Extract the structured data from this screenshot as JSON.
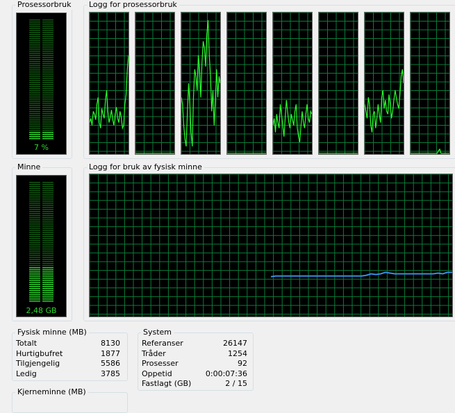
{
  "cpu": {
    "title": "Prosessorbruk",
    "value_label": "7 %",
    "fraction": 0.07
  },
  "cpu_history": {
    "title": "Logg for prosessorbruk",
    "cores": [
      [
        0.22,
        0.25,
        0.2,
        0.3,
        0.28,
        0.24,
        0.35,
        0.4,
        0.22,
        0.18,
        0.32,
        0.28,
        0.25,
        0.38,
        0.45,
        0.3,
        0.22,
        0.26,
        0.31,
        0.24,
        0.2,
        0.28,
        0.33,
        0.25,
        0.22,
        0.3,
        0.26,
        0.18,
        0.2,
        0.35,
        0.42,
        0.6,
        0.7
      ],
      [
        0.0,
        0.0,
        0.0,
        0.0,
        0.0,
        0.0,
        0.0,
        0.0,
        0.0,
        0.0,
        0.0,
        0.0,
        0.0,
        0.0,
        0.0,
        0.0,
        0.0,
        0.0,
        0.0,
        0.0,
        0.0,
        0.0,
        0.0,
        0.0,
        0.0,
        0.0,
        0.0,
        0.0,
        0.0,
        0.0,
        0.0,
        0.0,
        0.0
      ],
      [
        0.4,
        0.35,
        0.2,
        0.1,
        0.05,
        0.3,
        0.5,
        0.35,
        0.15,
        0.05,
        0.4,
        0.6,
        0.55,
        0.45,
        0.7,
        0.6,
        0.4,
        0.65,
        0.8,
        0.75,
        0.62,
        0.85,
        0.95,
        0.7,
        0.55,
        0.3,
        0.45,
        0.2,
        0.38,
        0.6,
        0.4,
        0.55,
        0.5
      ],
      [
        0.0,
        0.0,
        0.0,
        0.0,
        0.0,
        0.0,
        0.0,
        0.0,
        0.0,
        0.0,
        0.0,
        0.0,
        0.0,
        0.0,
        0.0,
        0.0,
        0.0,
        0.0,
        0.0,
        0.0,
        0.0,
        0.0,
        0.0,
        0.0,
        0.0,
        0.0,
        0.0,
        0.0,
        0.0,
        0.0,
        0.0,
        0.0,
        0.0
      ],
      [
        0.2,
        0.25,
        0.15,
        0.28,
        0.22,
        0.18,
        0.35,
        0.28,
        0.2,
        0.12,
        0.25,
        0.38,
        0.3,
        0.22,
        0.18,
        0.28,
        0.24,
        0.2,
        0.3,
        0.35,
        0.18,
        0.12,
        0.08,
        0.2,
        0.3,
        0.22,
        0.18,
        0.28,
        0.35,
        0.25,
        0.22,
        0.3,
        0.28
      ],
      [
        0.0,
        0.0,
        0.0,
        0.0,
        0.0,
        0.0,
        0.0,
        0.0,
        0.0,
        0.0,
        0.0,
        0.0,
        0.0,
        0.0,
        0.0,
        0.0,
        0.0,
        0.0,
        0.0,
        0.0,
        0.0,
        0.0,
        0.0,
        0.0,
        0.0,
        0.0,
        0.0,
        0.0,
        0.0,
        0.0,
        0.0,
        0.0,
        0.0
      ],
      [
        0.35,
        0.3,
        0.25,
        0.4,
        0.35,
        0.2,
        0.15,
        0.28,
        0.3,
        0.18,
        0.25,
        0.35,
        0.28,
        0.22,
        0.4,
        0.45,
        0.32,
        0.38,
        0.3,
        0.28,
        0.42,
        0.35,
        0.25,
        0.3,
        0.38,
        0.45,
        0.4,
        0.35,
        0.32,
        0.42,
        0.55,
        0.6,
        0.5
      ],
      [
        0.0,
        0.0,
        0.0,
        0.0,
        0.0,
        0.0,
        0.0,
        0.0,
        0.0,
        0.0,
        0.0,
        0.0,
        0.0,
        0.0,
        0.0,
        0.0,
        0.0,
        0.0,
        0.0,
        0.0,
        0.0,
        0.0,
        0.0,
        0.02,
        0.03,
        0.0,
        0.0,
        0.0,
        0.0,
        0.0,
        0.0,
        0.0,
        0.0
      ]
    ]
  },
  "memory": {
    "title": "Minne",
    "value_label": "2,48 GB",
    "fraction": 0.3
  },
  "memory_history": {
    "title": "Logg for bruk av fysisk minne",
    "start_fraction": 0.5,
    "values": [
      0.28,
      0.285,
      0.285,
      0.285,
      0.285,
      0.285,
      0.285,
      0.285,
      0.285,
      0.285,
      0.285,
      0.285,
      0.285,
      0.285,
      0.285,
      0.285,
      0.285,
      0.285,
      0.285,
      0.285,
      0.29,
      0.3,
      0.295,
      0.3,
      0.31,
      0.305,
      0.3,
      0.3,
      0.3,
      0.3,
      0.3,
      0.3,
      0.3,
      0.3,
      0.3,
      0.305,
      0.3,
      0.31,
      0.31
    ]
  },
  "physical_memory": {
    "title": "Fysisk minne (MB)",
    "rows": [
      {
        "label": "Totalt",
        "value": "8130"
      },
      {
        "label": "Hurtigbufret",
        "value": "1877"
      },
      {
        "label": "Tilgjengelig",
        "value": "5586"
      },
      {
        "label": "Ledig",
        "value": "3785"
      }
    ]
  },
  "system": {
    "title": "System",
    "rows": [
      {
        "label": "Referanser",
        "value": "26147"
      },
      {
        "label": "Tråder",
        "value": "1254"
      },
      {
        "label": "Prosesser",
        "value": "92"
      },
      {
        "label": "Oppetid",
        "value": "0:00:07:36"
      },
      {
        "label": "Fastlagt (GB)",
        "value": "2 / 15"
      }
    ]
  },
  "kernel_memory": {
    "title": "Kjerneminne (MB)"
  },
  "colors": {
    "meter_green": "#2bd82b",
    "meter_dim": "#0f5a0f",
    "grid": "#0a7d3a",
    "cpu_line": "#2bff2b",
    "mem_line": "#3a8ee6"
  }
}
